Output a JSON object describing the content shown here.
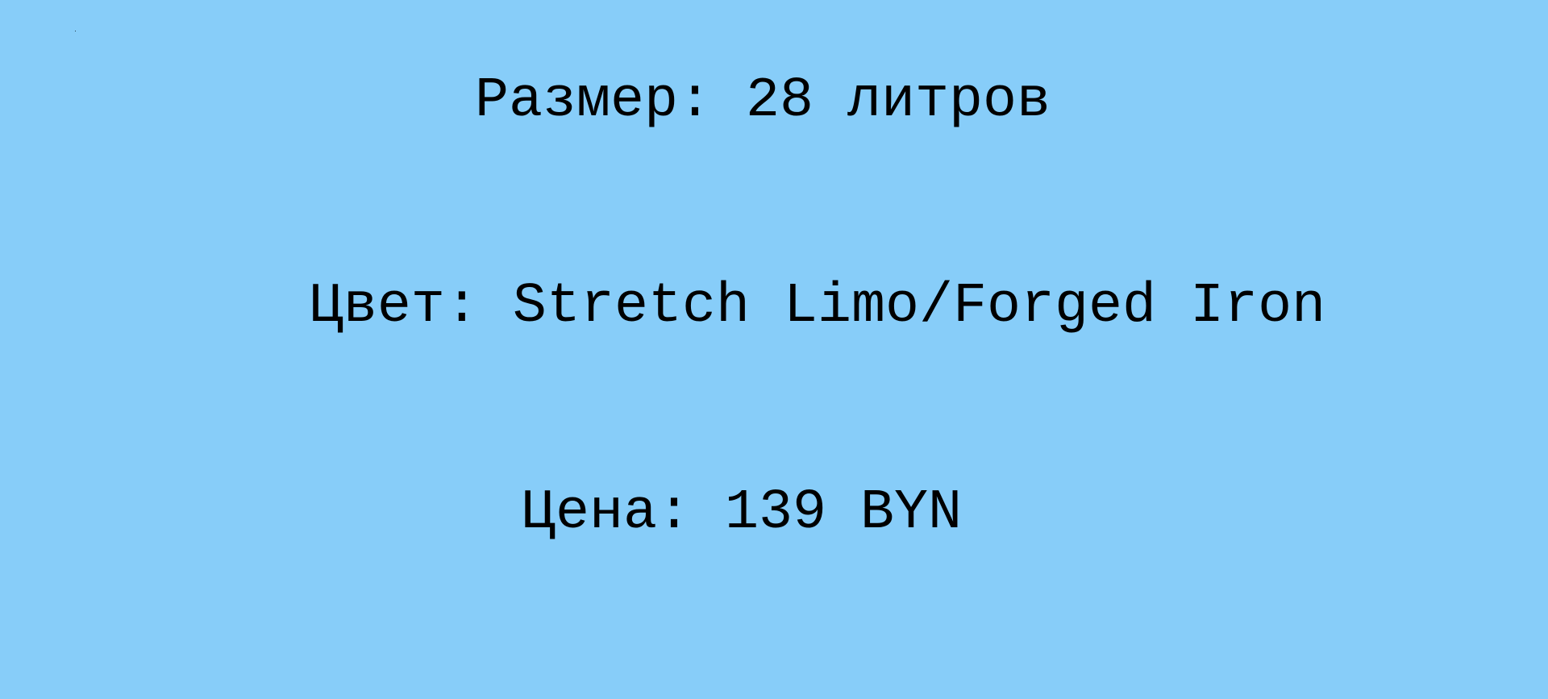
{
  "theme": {
    "background": "#87cdf9",
    "text_color": "#000000"
  },
  "product": {
    "size": "Размер: 28 литров",
    "color": "Цвет: Stretch Limo/Forged Iron",
    "price": "Цена: 139 BYN"
  }
}
